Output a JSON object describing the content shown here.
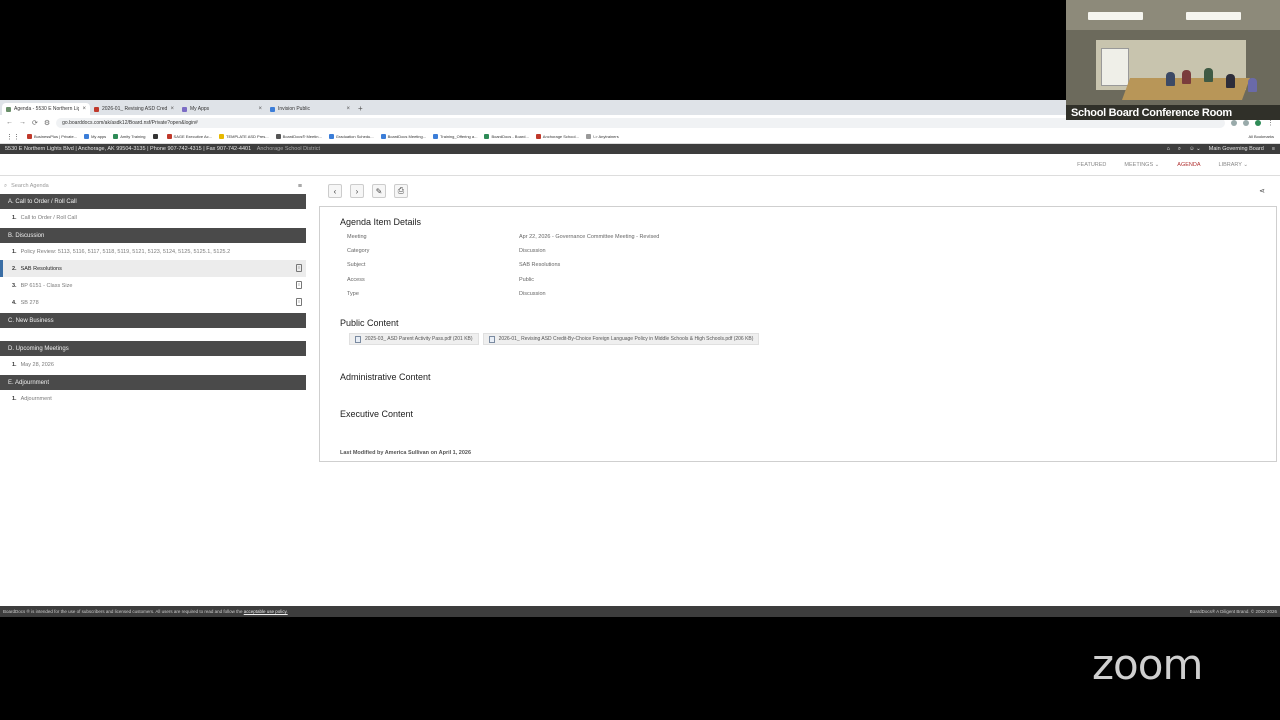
{
  "browser": {
    "tabs": [
      {
        "label": "Agenda - 5530 E Northern Lig",
        "active": true,
        "color": "#6a8f6a"
      },
      {
        "label": "2026-01_ Revising ASD Credit",
        "active": false,
        "color": "#c0392b"
      },
      {
        "label": "My Apps",
        "active": false,
        "color": "#7b6cc5"
      },
      {
        "label": "Invision Public",
        "active": false,
        "color": "#3b7dd8"
      }
    ],
    "new_tab": "+",
    "url": "go.boarddocs.com/ak/asdk12/Board.nsf/Private?open&login#",
    "bookmarks": [
      {
        "label": "BusinessPlus | Private...",
        "color": "#c0392b"
      },
      {
        "label": "My apps",
        "color": "#3b7dd8"
      },
      {
        "label": "Amity Training",
        "color": "#2e8b57"
      },
      {
        "label": "",
        "color": "#333333"
      },
      {
        "label": "SAGE Executive Ac...",
        "color": "#c0392b"
      },
      {
        "label": "TEMPLATE ASD Pres...",
        "color": "#e6b800"
      },
      {
        "label": "BoardDocs® Meetin...",
        "color": "#555555"
      },
      {
        "label": "Graduation Schedu...",
        "color": "#3b7dd8"
      },
      {
        "label": "BoardDocs Meeting...",
        "color": "#3b7dd8"
      },
      {
        "label": "Training_Offering a...",
        "color": "#3b7dd8"
      },
      {
        "label": "BoardDocs - Board...",
        "color": "#2e8b57"
      },
      {
        "label": "Anchorage School...",
        "color": "#c0392b"
      },
      {
        "label": "!-> Anytrainers",
        "color": "#999999"
      }
    ],
    "all_bookmarks": "All Bookmarks"
  },
  "site": {
    "address": "5530 E Northern Lights Blvd | Anchorage, AK 99504-3135 | Phone 907-742-4315 | Fax 907-742-4401",
    "district": "Anchorage School District",
    "board": "Main Governing Board"
  },
  "topnav": [
    {
      "label": "FEATURED",
      "active": false
    },
    {
      "label": "MEETINGS ⌄",
      "active": false
    },
    {
      "label": "AGENDA",
      "active": true
    },
    {
      "label": "LIBRARY ⌄",
      "active": false
    }
  ],
  "agenda": {
    "search_placeholder": "Search Agenda",
    "sections": [
      {
        "title": "A. Call to Order / Roll Call",
        "items": [
          {
            "num": "1.",
            "label": "Call to Order / Roll Call",
            "doc": false,
            "selected": false
          }
        ]
      },
      {
        "title": "B. Discussion",
        "items": [
          {
            "num": "1.",
            "label": "Policy Review: 5113, 5116, 5117, 5118, 5119, 5121, 5123, 5124, 5125, 5125.1, 5125.2",
            "doc": false,
            "selected": false
          },
          {
            "num": "2.",
            "label": "SAB Resolutions",
            "doc": true,
            "selected": true
          },
          {
            "num": "3.",
            "label": "BP 6151 - Class Size",
            "doc": true,
            "selected": false
          },
          {
            "num": "4.",
            "label": "SB 278",
            "doc": true,
            "selected": false
          }
        ]
      },
      {
        "title": "C. New Business",
        "items": []
      },
      {
        "title": "D. Upcoming Meetings",
        "items": [
          {
            "num": "1.",
            "label": "May 28, 2026",
            "doc": false,
            "selected": false
          }
        ]
      },
      {
        "title": "E. Adjournment",
        "items": [
          {
            "num": "1.",
            "label": "Adjournment",
            "doc": false,
            "selected": false
          }
        ]
      }
    ]
  },
  "detail": {
    "title": "Agenda Item Details",
    "fields": [
      {
        "key": "Meeting",
        "value": "Apr 22, 2026 - Governance Committee Meeting - Revised"
      },
      {
        "key": "Category",
        "value": "Discussion"
      },
      {
        "key": "Subject",
        "value": "SAB Resolutions"
      },
      {
        "key": "Access",
        "value": "Public"
      },
      {
        "key": "Type",
        "value": "Discussion"
      }
    ],
    "public_content": "Public Content",
    "attachments": [
      "2025-03_ ASD Parent Activity Pass.pdf (201 KB)",
      "2026-01_ Revising ASD Credit-By-Choice Foreign Language Policy in Middle Schools & High Schools.pdf (206 KB)"
    ],
    "administrative_content": "Administrative Content",
    "executive_content": "Executive Content",
    "last_modified": "Last Modified by America Sullivan on April 1, 2026"
  },
  "footer": {
    "left_prefix": "BoardDocs ® is intended for the use of subscribers and licensed customers. All users are required to read and follow the",
    "left_link": "acceptable use policy.",
    "right": "BoardDocs® A Diligent Brand. © 2002-2026"
  },
  "zoom": {
    "camera_label": "School Board Conference Room",
    "logo": "zoom"
  }
}
